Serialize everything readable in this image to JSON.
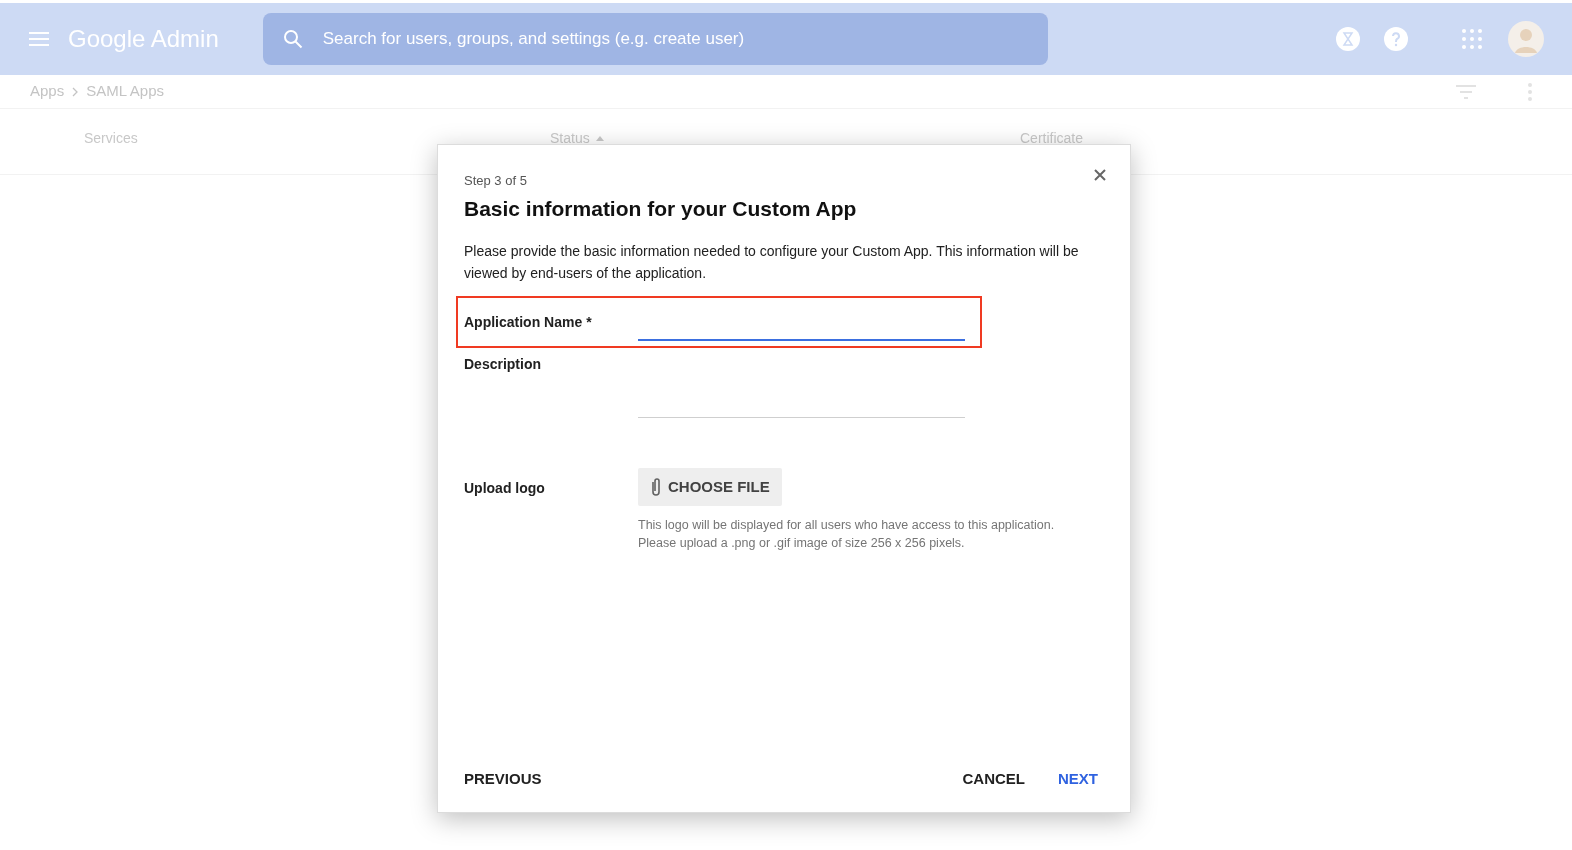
{
  "app_bar": {
    "title": "Google Admin",
    "search": {
      "placeholder": "Search for users, groups, and settings (e.g. create user)"
    }
  },
  "breadcrumb": [
    "Apps",
    "SAML Apps"
  ],
  "table": {
    "columns": [
      {
        "label": "Services",
        "sorted": false
      },
      {
        "label": "Status",
        "sorted": true
      },
      {
        "label": "Certificate",
        "sorted": false
      }
    ]
  },
  "dialog": {
    "step": "Step 3 of 5",
    "title": "Basic information for your Custom App",
    "intro": "Please provide the basic information needed to configure your Custom App. This information will be viewed by end-users of the application.",
    "fields": [
      {
        "kind": "text",
        "label": "Application Name *",
        "focused": true,
        "highlighted": true
      },
      {
        "kind": "textarea",
        "label": "Description",
        "focused": false,
        "highlighted": false
      },
      {
        "kind": "file",
        "label": "Upload logo",
        "button": "CHOOSE FILE",
        "hint": "This logo will be displayed for all users who have access to this application.\nPlease upload a .png or .gif image of size 256 x 256 pixels."
      }
    ],
    "buttons": {
      "previous": "PREVIOUS",
      "cancel": "CANCEL",
      "next": "NEXT"
    }
  }
}
